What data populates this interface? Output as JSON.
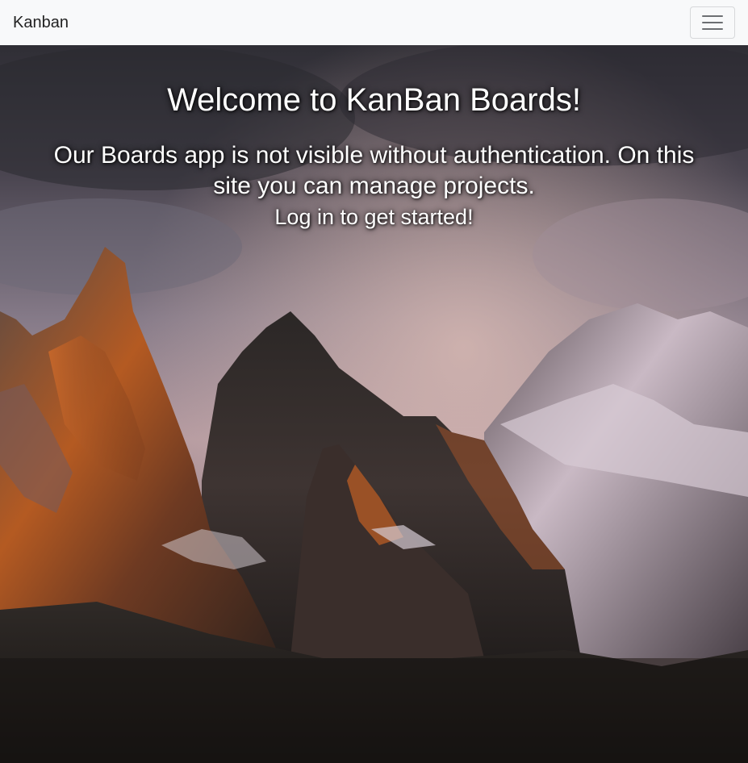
{
  "navbar": {
    "brand": "Kanban",
    "toggle_icon": "hamburger-menu-icon"
  },
  "hero": {
    "background": "mountain-landscape-photo",
    "title": "Welcome to KanBan Boards!",
    "description": "Our Boards app is not visible without authentication. On this site you can manage projects.",
    "call_to_action": "Log in to get started!"
  },
  "colors": {
    "navbar_bg": "#f8f9fa",
    "hero_text": "#ffffff",
    "sky_top": "#3b3942",
    "sky_mid": "#8a7f8e",
    "sunlit_rock": "#c2642a",
    "snow": "#d9cdd6",
    "shadow_ground": "#1f1d1c"
  }
}
